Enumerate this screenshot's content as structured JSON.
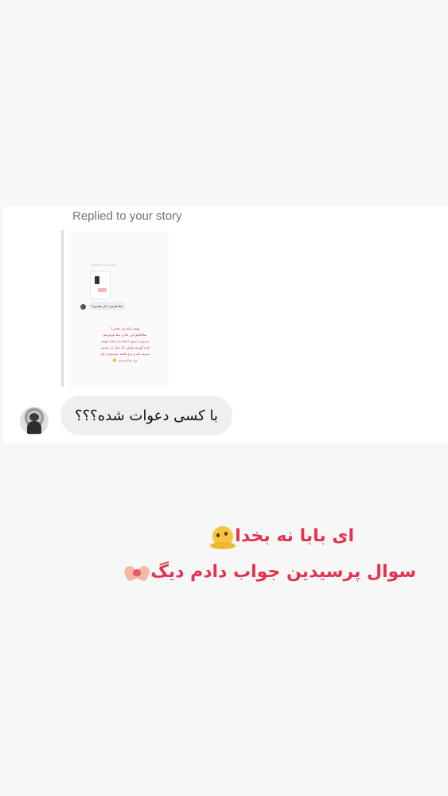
{
  "dm": {
    "replied_label": "Replied to your story",
    "message": "با کسی دعوات شده؟؟؟",
    "story_preview": {
      "mini_label": "Replied to your story",
      "mini_bubble": "خط قرمزت کی هستن؟",
      "lines": [
        "بهتیه رکیم چی هستی!",
        "منلاکلابلرادین عادی خط قرمزمنم",
        "دو روپی ابرو‌ی اعتیاد و از همه مهمتر",
        "کنده گوزیم طرفی که خیلی از خودش",
        "تعریف کنه و بدخ بکشه خودشو از بکر",
        "من جذاب‌ترمی 🙂"
      ]
    }
  },
  "caption": {
    "line1": "ای بابا نه بخدا",
    "line2": "سوال پرسیدین جواب دادم دیگ"
  },
  "icons": {
    "emoji1": "melting-face-icon",
    "emoji2": "heart-hands-icon"
  },
  "colors": {
    "caption": "#e2334e",
    "bubble": "#efeff1",
    "background": "#f7f7f7"
  }
}
